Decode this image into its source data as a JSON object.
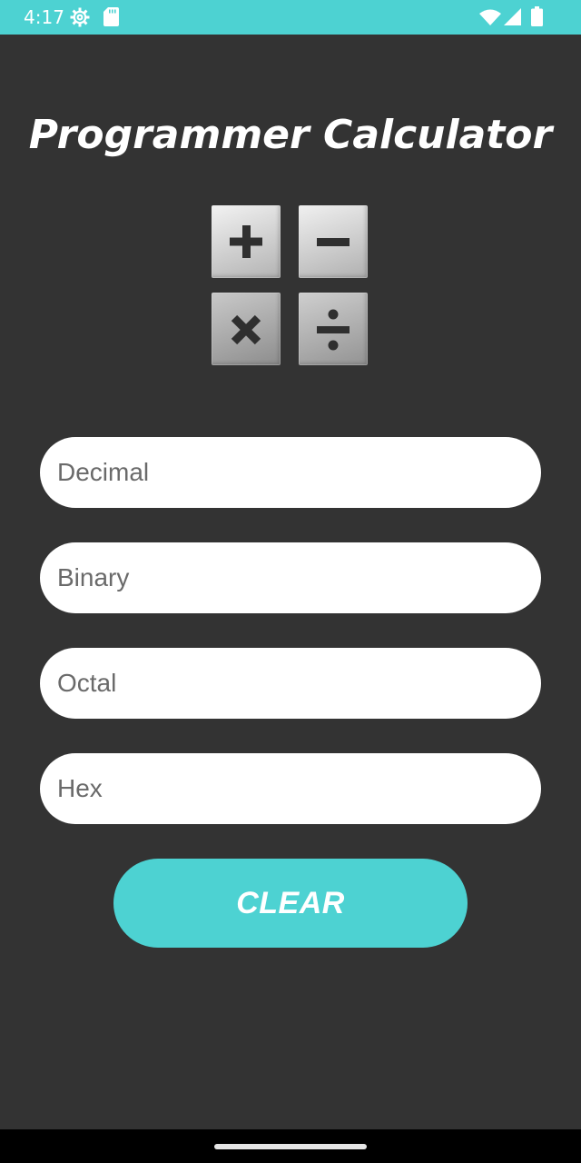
{
  "status_bar": {
    "time": "4:17",
    "icons": [
      "settings-icon",
      "sd-card-icon",
      "wifi-icon",
      "signal-icon",
      "battery-icon"
    ],
    "background_color": "#4dd2d2"
  },
  "app": {
    "title": "Programmer Calculator",
    "logo_icon": "calculator-operations-icon",
    "background_color": "#333333",
    "accent_color": "#4dd2d2"
  },
  "fields": {
    "decimal": {
      "value": "",
      "placeholder": "Decimal"
    },
    "binary": {
      "value": "",
      "placeholder": "Binary"
    },
    "octal": {
      "value": "",
      "placeholder": "Octal"
    },
    "hex": {
      "value": "",
      "placeholder": "Hex"
    }
  },
  "actions": {
    "clear_label": "CLEAR"
  },
  "navigation": {
    "home_indicator": "home-handle"
  }
}
